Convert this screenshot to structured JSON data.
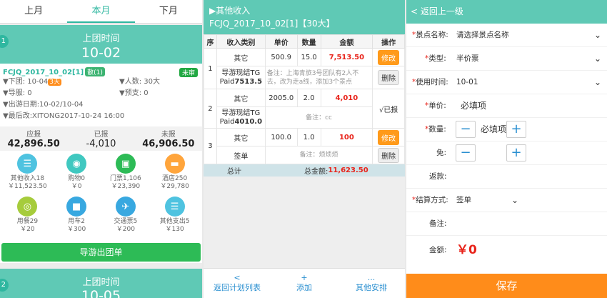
{
  "p1": {
    "tabs": [
      "上月",
      "本月",
      "下月"
    ],
    "group1": {
      "num": "1",
      "label": "上团时间",
      "date": "10-02"
    },
    "card": {
      "code": "FCJQ_2017_10_02[1]",
      "pill": "散(1)",
      "status": "未审",
      "down": "▼下团: 10-04",
      "days": "3天",
      "people": "▼人数: 30大",
      "guide": "▼导服: 0",
      "prepay": "▼预支: 0",
      "trip": "▼出游日期:10-02/10-04",
      "modified": "▼最后改:XITONG2017-10-24 16:00"
    },
    "summary": {
      "h": [
        "应报",
        "已报",
        "未报"
      ],
      "v": [
        "42,896.50",
        "-4,010",
        "46,906.50"
      ]
    },
    "icons": [
      {
        "name": "other-income-icon",
        "glyph": "☰",
        "color": "#4fc3e0",
        "t": "其他收入18",
        "m": "￥11,523.50"
      },
      {
        "name": "shopping-icon",
        "glyph": "◉",
        "color": "#40c8c0",
        "t": "购物0",
        "m": "￥0"
      },
      {
        "name": "ticket-icon",
        "glyph": "▣",
        "color": "#2dbb56",
        "t": "门票1,106",
        "m": "￥23,390"
      },
      {
        "name": "hotel-icon",
        "glyph": "▬",
        "color": "#ffa53c",
        "t": "酒店250",
        "m": "￥29,780"
      },
      {
        "name": "meal-icon",
        "glyph": "◎",
        "color": "#a6cc3c",
        "t": "用餐29",
        "m": "￥20"
      },
      {
        "name": "car-icon",
        "glyph": "■",
        "color": "#38a8e0",
        "t": "用车2",
        "m": "￥300"
      },
      {
        "name": "plane-icon",
        "glyph": "✈",
        "color": "#38a8e0",
        "t": "交通票5",
        "m": "￥200"
      },
      {
        "name": "other-expense-icon",
        "glyph": "☰",
        "color": "#4fc3e0",
        "t": "其他支出5",
        "m": "￥130"
      }
    ],
    "go_button": "导游出团单",
    "group2": {
      "num": "2",
      "label": "上团时间",
      "date": "10-05"
    }
  },
  "p2": {
    "title": "▶其他收入",
    "sub": "FCJQ_2017_10_02[1]【30大】",
    "headers": [
      "序",
      "收入类别",
      "单价",
      "数量",
      "金额",
      "操作"
    ],
    "rows": [
      {
        "no": "1",
        "cat": "其它",
        "price": "500.9",
        "qty": "15.0",
        "amount": "7,513.50",
        "op": "修改",
        "src1": "导游现结TG",
        "src2a": "Paid",
        "src2b": "7513.5",
        "note": "备注：上海青旅3号团队有2人不去，改为走a线，添加3个景点",
        "op2": "删除"
      },
      {
        "no": "2",
        "cat": "其它",
        "price": "2005.0",
        "qty": "2.0",
        "amount": "4,010",
        "op": "√已报",
        "src1": "导游现结TG",
        "src2a": "Paid",
        "src2b": "4010.0",
        "note": "备注：cc"
      },
      {
        "no": "3",
        "cat": "其它",
        "price": "100.0",
        "qty": "1.0",
        "amount": "100",
        "op": "修改",
        "src1": "签单",
        "note": "备注：烦烦烦",
        "op2": "删除"
      }
    ],
    "total_label": "总计",
    "total_text": "总金额:",
    "total_value": "11,623.50",
    "bottom": [
      {
        "g": "<",
        "t": "返回计划列表"
      },
      {
        "g": "+",
        "t": "添加"
      },
      {
        "g": "...",
        "t": "其他安排"
      }
    ]
  },
  "p3": {
    "back": "< 返回上一级",
    "spot_label": "景点名称:",
    "spot_ph": "请选择景点名称",
    "type_label": "类型:",
    "type_val": "半价票",
    "date_label": "使用时间:",
    "date_val": "10-01",
    "price_label": "单价:",
    "price_ph": "必填项",
    "qty_label": "数量:",
    "qty_ph": "必填项",
    "free_label": "免:",
    "rebate_label": "返款:",
    "settle_label": "结算方式:",
    "settle_val": "签单",
    "remark_label": "备注:",
    "amount_label": "金额:",
    "amount_val": "￥0",
    "save": "保存"
  }
}
